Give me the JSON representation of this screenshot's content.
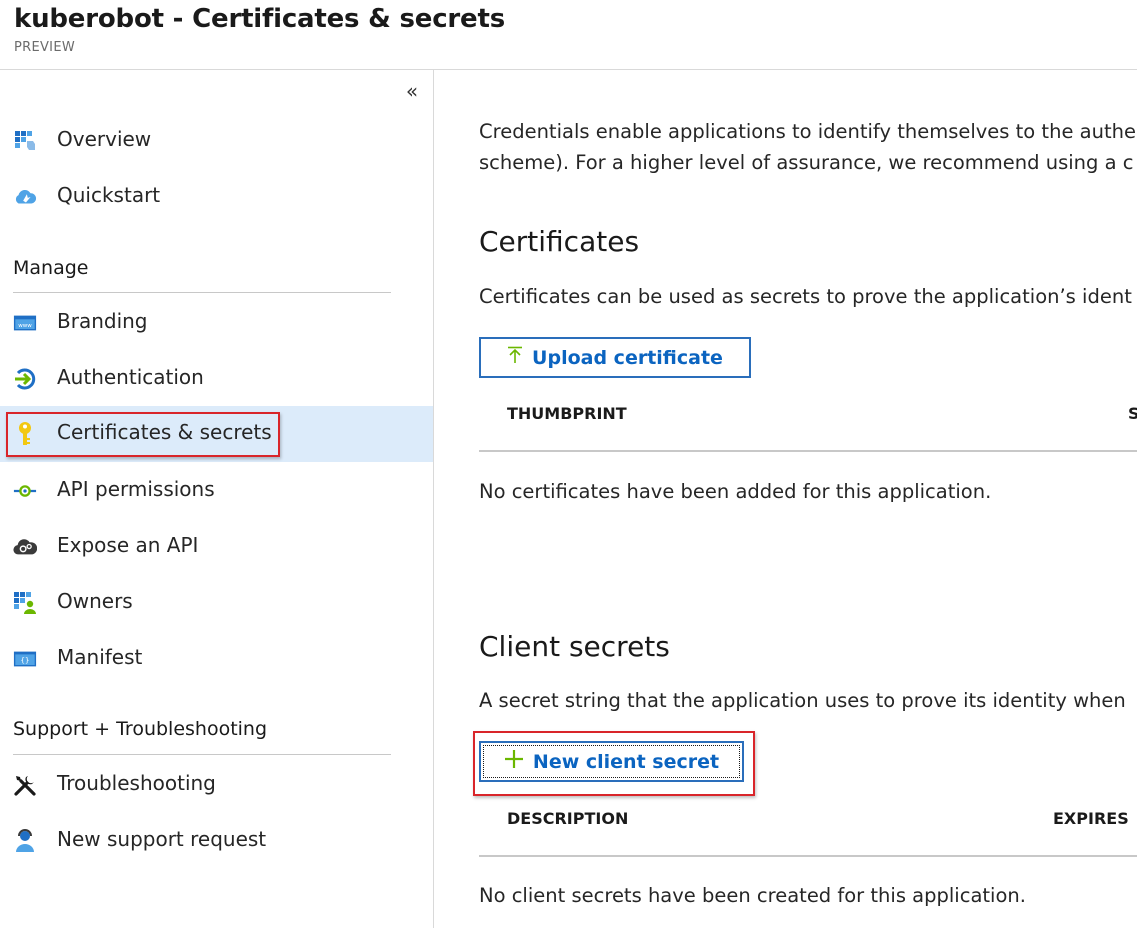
{
  "header": {
    "title": "kuberobot - Certificates & secrets",
    "subtitle": "PREVIEW"
  },
  "sidebar": {
    "collapse_glyph": "«",
    "top_items": [
      {
        "label": "Overview",
        "icon": "overview-grid-icon"
      },
      {
        "label": "Quickstart",
        "icon": "quickstart-cloud-icon"
      }
    ],
    "manage_heading": "Manage",
    "manage_items": [
      {
        "label": "Branding",
        "icon": "branding-www-icon"
      },
      {
        "label": "Authentication",
        "icon": "authentication-arrow-icon"
      },
      {
        "label": "Certificates & secrets",
        "icon": "key-icon",
        "selected": true
      },
      {
        "label": "API permissions",
        "icon": "api-permissions-icon"
      },
      {
        "label": "Expose an API",
        "icon": "expose-api-cloud-gear-icon"
      },
      {
        "label": "Owners",
        "icon": "owners-grid-user-icon"
      },
      {
        "label": "Manifest",
        "icon": "manifest-braces-icon"
      }
    ],
    "support_heading": "Support + Troubleshooting",
    "support_items": [
      {
        "label": "Troubleshooting",
        "icon": "wrench-screwdriver-icon"
      },
      {
        "label": "New support request",
        "icon": "support-person-icon"
      }
    ]
  },
  "main": {
    "intro_line1": "Credentials enable applications to identify themselves to the authe",
    "intro_line2": "scheme). For a higher level of assurance, we recommend using a c",
    "certificates": {
      "heading": "Certificates",
      "description": "Certificates can be used as secrets to prove the application’s ident",
      "upload_button": "Upload certificate",
      "col_thumbprint": "THUMBPRINT",
      "col_partial": "S",
      "empty_text": "No certificates have been added for this application."
    },
    "client_secrets": {
      "heading": "Client secrets",
      "description": "A secret string that the application uses to prove its identity when",
      "new_button": "New client secret",
      "col_description": "DESCRIPTION",
      "col_expires": "EXPIRES",
      "empty_text": "No client secrets have been created for this application."
    }
  },
  "colors": {
    "accent_blue": "#0b64c0",
    "selected_bg": "#dcebfa",
    "highlight_red": "#d9252a",
    "plus_green": "#6bb700"
  }
}
